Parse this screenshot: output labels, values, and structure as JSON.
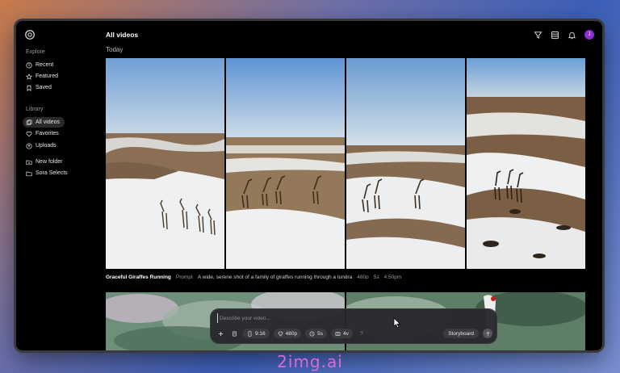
{
  "sidebar": {
    "explore_label": "Explore",
    "explore_items": [
      {
        "label": "Recent",
        "icon": "recent-icon"
      },
      {
        "label": "Featured",
        "icon": "star-icon"
      },
      {
        "label": "Saved",
        "icon": "bookmark-icon"
      }
    ],
    "library_label": "Library",
    "library_items": [
      {
        "label": "All videos",
        "icon": "videos-icon",
        "active": true
      },
      {
        "label": "Favorites",
        "icon": "heart-icon"
      },
      {
        "label": "Uploads",
        "icon": "upload-icon"
      }
    ],
    "folder_items": [
      {
        "label": "New folder",
        "icon": "new-folder-icon"
      },
      {
        "label": "Sora Selects",
        "icon": "folder-icon"
      }
    ]
  },
  "header": {
    "title": "All videos",
    "avatar_initial": "J"
  },
  "section": {
    "date": "Today"
  },
  "video": {
    "title": "Graceful Giraffes Running",
    "prompt_label": "Prompt",
    "prompt_text": "A wide, serene shot of a family of giraffes running through a tundra",
    "resolution": "480p",
    "duration": "5s",
    "time": "4:50pm"
  },
  "composer": {
    "placeholder": "Describe your video...",
    "aspect": "9:16",
    "resolution": "480p",
    "duration": "5s",
    "variations": "4v",
    "help": "?",
    "storyboard_label": "Storyboard"
  },
  "watermark": "2img.ai",
  "colors": {
    "accent": "#8b2fd1",
    "window_bg": "#000000",
    "composer_bg": "#28282c"
  }
}
